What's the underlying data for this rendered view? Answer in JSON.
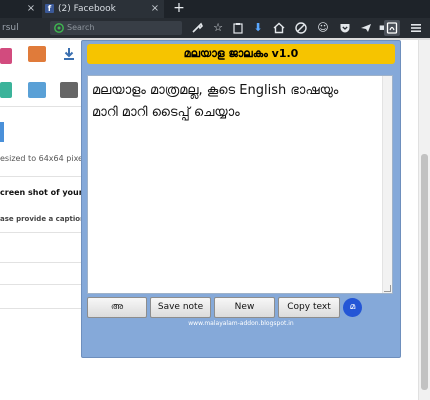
{
  "browser": {
    "tabs": [
      {
        "label": "",
        "active": false
      },
      {
        "label": "(2) Facebook",
        "active": true
      }
    ],
    "tab_close_glyph": "×",
    "new_tab_glyph": "+",
    "url_fragment": "rsul",
    "search_placeholder": "Search",
    "toolbar_icons": [
      "wrench-icon",
      "star-icon",
      "clipboard-icon",
      "download-icon",
      "home-icon",
      "no-icon",
      "emoji-icon",
      "pocket-icon",
      "send-icon",
      "media-icon",
      "extension-icon",
      "menu-icon"
    ]
  },
  "background_page": {
    "resize_note": "esized to 64x64 pixels i",
    "screenshot_prompt": "creen shot of your a",
    "caption_prompt": "ase provide a caption",
    "tile_colors": [
      "#d24b7e",
      "#e07b3a",
      "#3a6fb0",
      "#3bb39a",
      "#5aa0d6",
      "#666666"
    ]
  },
  "popup": {
    "title": "മലയാള ജാലകം v1.0",
    "editor_text": "മലയാളം മാത്രമല്ല, കൂടെ English ഭാഷയും\nമാറി മാറി ടൈപ്പ് ചെയ്യാം",
    "buttons": {
      "toggle": "അ",
      "save": "Save note",
      "new": "New",
      "copy": "Copy text",
      "circle": "മ"
    },
    "footer": "www.malayalam-addon.blogspot.in",
    "colors": {
      "title_bg": "#f6c400",
      "panel_bg": "#85a9d9",
      "circle_bg": "#2456d6"
    }
  }
}
